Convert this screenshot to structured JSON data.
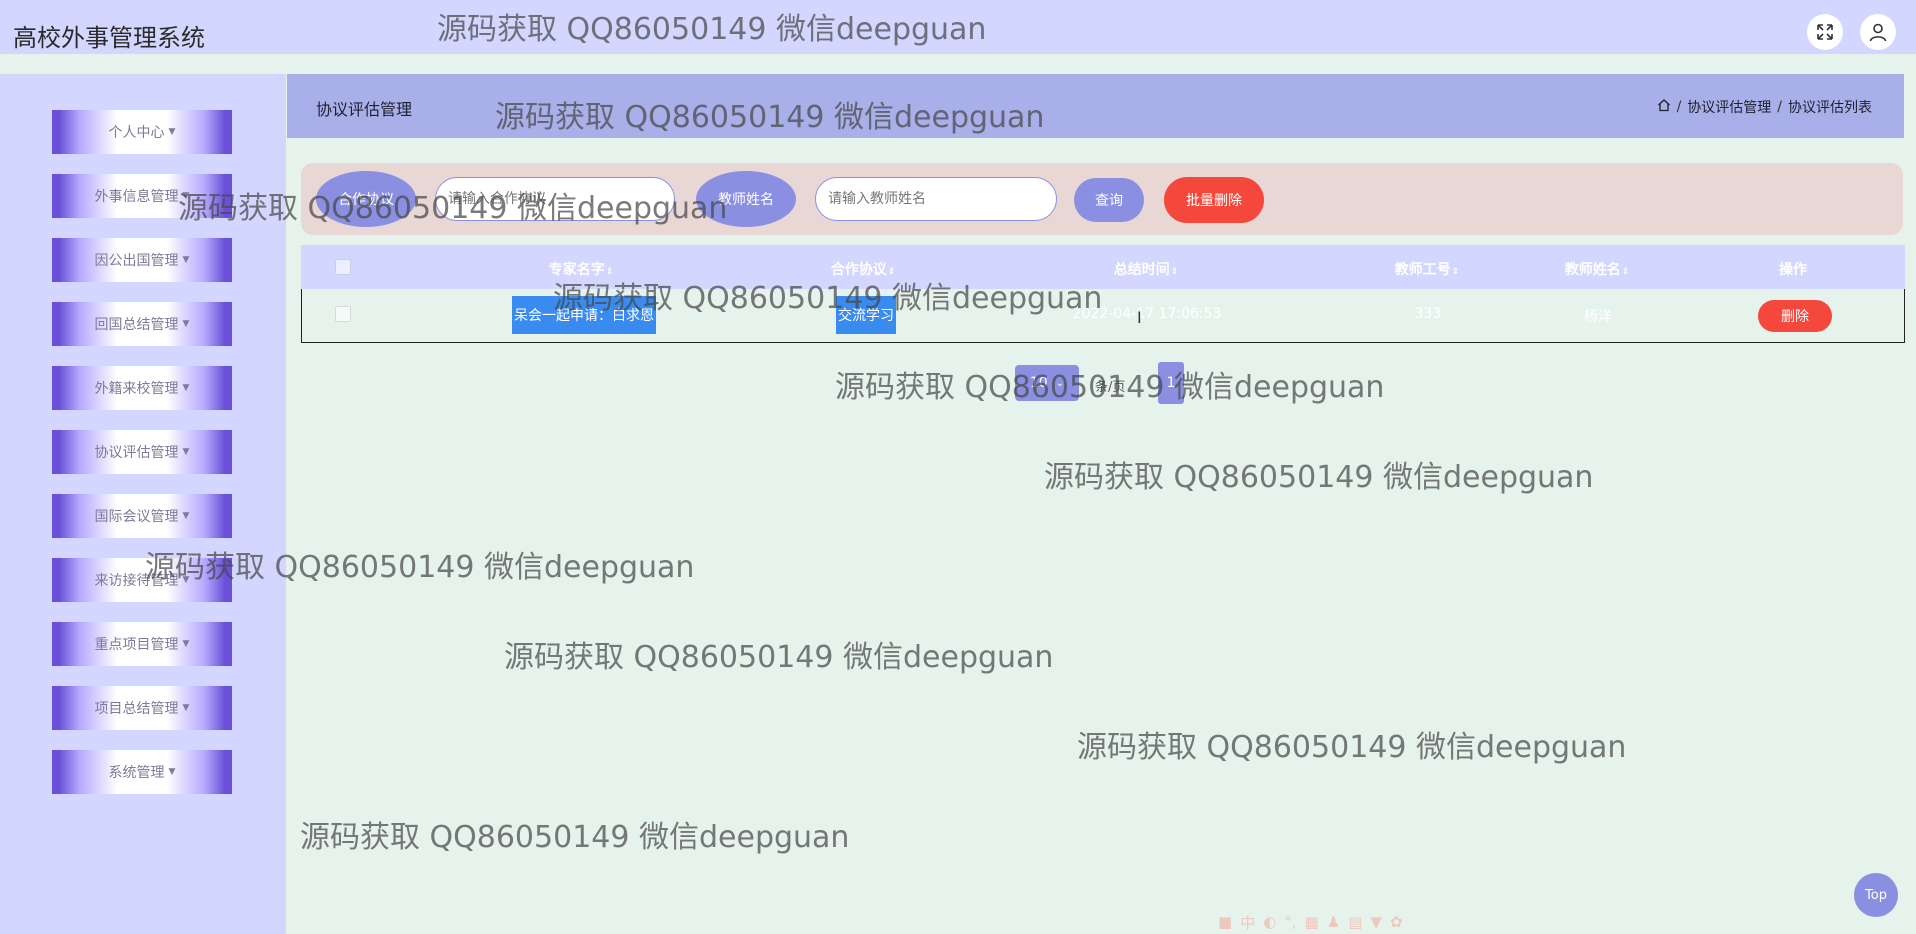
{
  "header": {
    "title": "高校外事管理系统",
    "fullscreen_icon": "expand-icon",
    "user_icon": "user-icon"
  },
  "sidebar": {
    "items": [
      {
        "label": "个人中心"
      },
      {
        "label": "外事信息管理"
      },
      {
        "label": "因公出国管理"
      },
      {
        "label": "回国总结管理"
      },
      {
        "label": "外籍来校管理"
      },
      {
        "label": "协议评估管理"
      },
      {
        "label": "国际会议管理"
      },
      {
        "label": "来访接待管理"
      },
      {
        "label": "重点项目管理"
      },
      {
        "label": "项目总结管理"
      },
      {
        "label": "系统管理"
      }
    ]
  },
  "breadcrumb": {
    "section_title": "协议评估管理",
    "home_icon": "home-icon",
    "path": [
      "协议评估管理",
      "协议评估列表"
    ]
  },
  "search": {
    "label1": "合作协议",
    "placeholder1": "请输入合作协议",
    "label2": "教师姓名",
    "placeholder2": "请输入教师姓名",
    "query_label": "查询",
    "batch_delete_label": "批量删除"
  },
  "table": {
    "columns": [
      "专家名字",
      "合作协议",
      "总结时间",
      "教师工号",
      "教师姓名",
      "操作"
    ],
    "rows": [
      {
        "expert": "呆会一起申请：白求恩",
        "agreement": "交流学习",
        "time": "2022-04-17 17:06:53",
        "teacher_id": "333",
        "teacher_name": "杨洋",
        "action": "删除"
      }
    ]
  },
  "pagination": {
    "page_size": "10",
    "page_size_label": "条/页",
    "current_page": "1"
  },
  "top_button": "Top",
  "watermark_text": "源码获取 QQ86050149 微信deepguan",
  "colors": {
    "header_bg": "#d3d7ff",
    "accent": "#8a8fe1",
    "danger": "#f5483d",
    "menu_border": "#6b4fd8",
    "page_bg": "#e6f3ec"
  }
}
